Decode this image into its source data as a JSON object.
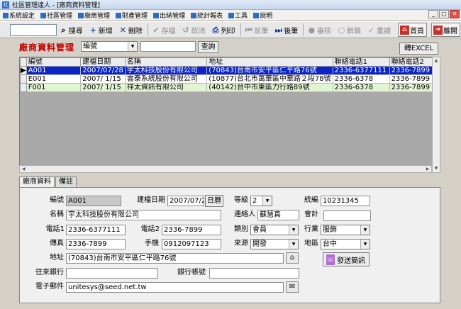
{
  "window": {
    "title": "社區管理達人 - [廠商資料管理]",
    "app_icon": "社",
    "buttons": [
      "_",
      "□",
      "✕"
    ]
  },
  "menu": [
    "系統設定",
    "社區管理",
    "廠商管理",
    "財產管理",
    "出納管理",
    "統計報表",
    "工具",
    "說明"
  ],
  "toolbar": {
    "search_value": "",
    "search": "搜尋",
    "add": "新增",
    "delete": "刪除",
    "save": "存檔",
    "cancel": "取消",
    "print": "列印",
    "prev": "前筆",
    "next": "後筆",
    "audit": "審核",
    "unlock": "解鎖",
    "reset": "重讀",
    "home": "首頁",
    "exit": "離開"
  },
  "page_title": "廠商資料管理",
  "filter": {
    "field": "編號",
    "value": "",
    "query_button": "查詢",
    "excel_button": "轉EXCEL"
  },
  "grid": {
    "columns": [
      "編號",
      "建檔日期",
      "名稱",
      "地址",
      "聯絡電話1",
      "聯絡電話2"
    ],
    "rows": [
      [
        "A001",
        "2007/07/28",
        "宇太科技股份有限公司",
        "(70843)台南市安平區仁平路76號",
        "2336-6377111",
        "2336-7899"
      ],
      [
        "E001",
        "2007/ 1/15",
        "雲泰系統股份有限公司",
        "(10877)台北市萬華區中華路２段78號",
        "2336-6378",
        "2336-7899"
      ],
      [
        "F001",
        "2007/ 1/15",
        "祥太資訊有限公司",
        "(40142)台中市東區力行路89號",
        "2336-6378",
        "2336-7899"
      ]
    ]
  },
  "tabs": [
    "廠商資料",
    "備註"
  ],
  "form": {
    "id_label": "編號",
    "id": "A001",
    "created_label": "建檔日期",
    "created": "2007/07/28",
    "calendar_button": "日曆",
    "grade_label": "等級",
    "grade": "2",
    "taxid_label": "統編",
    "taxid": "10231345",
    "name_label": "名稱",
    "name": "宇太科技股份有限公司",
    "contact_label": "連絡人",
    "contact": "蘇慧真",
    "accountant_label": "會計",
    "accountant": "",
    "phone1_label": "電話1",
    "phone1": "2336-6377111",
    "phone2_label": "電話2",
    "phone2": "2336-7899",
    "category_label": "類別",
    "category": "會員",
    "industry_label": "行業",
    "industry": "服飾",
    "fax_label": "傳真",
    "fax": "2336-7899",
    "mobile_label": "手機",
    "mobile": "0912097123",
    "source_label": "來源",
    "source": "開發",
    "region_label": "地區",
    "region": "台中",
    "address_label": "地址",
    "address": "(70843)台南市安平區仁平路76號",
    "bank_label": "往來銀行",
    "bank": "",
    "account_label": "銀行帳號",
    "account": "",
    "email_label": "電子郵件",
    "email": "unitesys@seed.net.tw",
    "sms_button": "發送簡訊"
  }
}
